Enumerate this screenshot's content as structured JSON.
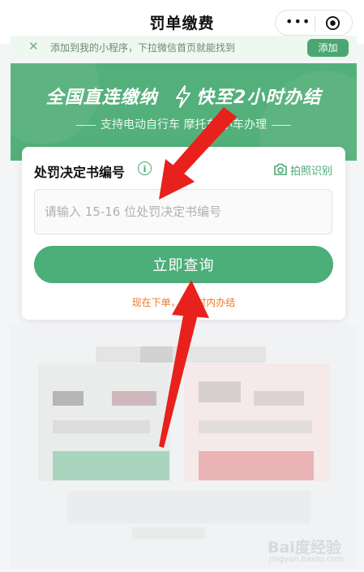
{
  "navbar": {
    "title": "罚单缴费",
    "more_icon": "more-dots-icon",
    "close_icon": "target-circle-icon"
  },
  "add_banner": {
    "tip": "添加到我的小程序，下拉微信首页就能找到",
    "add_label": "添加",
    "close_icon": "close-icon"
  },
  "hero": {
    "title_left": "全国直连缴纳",
    "title_right": "快至2小时办结",
    "subtitle": "支持电动自行车 摩托车 小车办理",
    "bolt_icon": "lightning-bolt-icon"
  },
  "form": {
    "label": "处罚决定书编号",
    "info_icon": "info-icon",
    "photo_label": "拍照识别",
    "camera_icon": "camera-icon",
    "input_placeholder": "请输入 15-16 位处罚决定书编号",
    "input_value": "",
    "submit_label": "立即查询",
    "promo_text": "现在下单，2小时内办结"
  },
  "watermark": {
    "brand": "Bai度经验",
    "url": "jingyan.baidu.com"
  },
  "colors": {
    "accent": "#4cae78",
    "hero_bg": "#53b07a",
    "promo": "#ea7a2b",
    "arrow": "#e8211c"
  }
}
